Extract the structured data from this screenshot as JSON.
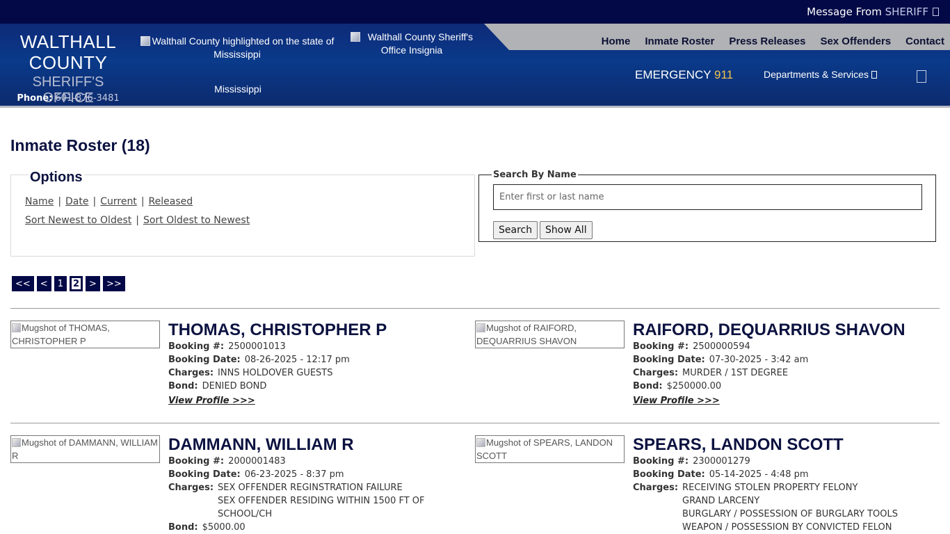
{
  "topbar": {
    "message_prefix": "Message From",
    "message_sheriff": "SHERIFF"
  },
  "logo": {
    "title_line1": "WALTHALL",
    "title_line2": "COUNTY",
    "subtitle": "SHERIFF'S OFFICE",
    "phone_label": "Phone:",
    "phone_number": "601-876-3481"
  },
  "state_image": {
    "alt": "Walthall County highlighted on the state of Mississippi",
    "label": "Mississippi"
  },
  "insignia_image": {
    "alt": "Walthall County Sheriff's Office Insignia"
  },
  "nav": [
    "Home",
    "Inmate Roster",
    "Press Releases",
    "Sex Offenders",
    "Contact"
  ],
  "emergency": {
    "label": "EMERGENCY",
    "number": "911"
  },
  "departments": {
    "label": "Departments & Services"
  },
  "page": {
    "title": "Inmate Roster (18)"
  },
  "options": {
    "legend": "Options",
    "filters": [
      "Name",
      "Date",
      "Current",
      "Released"
    ],
    "sorts": [
      "Sort Newest to Oldest",
      "Sort Oldest to Newest"
    ]
  },
  "search": {
    "legend": "Search By Name",
    "placeholder": "Enter first or last name",
    "search_button": "Search",
    "show_all_button": "Show All"
  },
  "pager": {
    "items": [
      "<<",
      "<",
      "1",
      "2",
      ">",
      ">>"
    ],
    "current": "2"
  },
  "labels": {
    "booking_no": "Booking #:",
    "booking_date": "Booking Date:",
    "charges": "Charges:",
    "bond": "Bond:",
    "view_profile": "View Profile >>>"
  },
  "inmates": [
    {
      "mug_alt": "Mugshot of THOMAS, CHRISTOPHER P",
      "name": "THOMAS, CHRISTOPHER P",
      "booking_no": "2500001013",
      "booking_date": "08-26-2025 - 12:17 pm",
      "charges": "INNS HOLDOVER GUESTS",
      "bond": "DENIED BOND"
    },
    {
      "mug_alt": "Mugshot of RAIFORD, DEQUARRIUS SHAVON",
      "name": "RAIFORD, DEQUARRIUS SHAVON",
      "booking_no": "2500000594",
      "booking_date": "07-30-2025 - 3:42 am",
      "charges": "MURDER / 1ST DEGREE",
      "bond": "$250000.00"
    },
    {
      "mug_alt": "Mugshot of DAMMANN, WILLIAM R",
      "name": "DAMMANN, WILLIAM R",
      "booking_no": "2000001483",
      "booking_date": "06-23-2025 - 8:37 pm",
      "charges": "SEX OFFENDER REGINSTRATION FAILURE\nSEX OFFENDER RESIDING WITHIN 1500 FT OF\nSCHOOL/CH",
      "bond": "$5000.00"
    },
    {
      "mug_alt": "Mugshot of SPEARS, LANDON SCOTT",
      "name": "SPEARS, LANDON SCOTT",
      "booking_no": "2300001279",
      "booking_date": "05-14-2025 - 4:48 pm",
      "charges": "RECEIVING STOLEN PROPERTY FELONY\nGRAND LARCENY\nBURGLARY / POSSESSION OF BURGLARY TOOLS\nWEAPON / POSSESSION BY CONVICTED FELON",
      "bond": ""
    }
  ]
}
